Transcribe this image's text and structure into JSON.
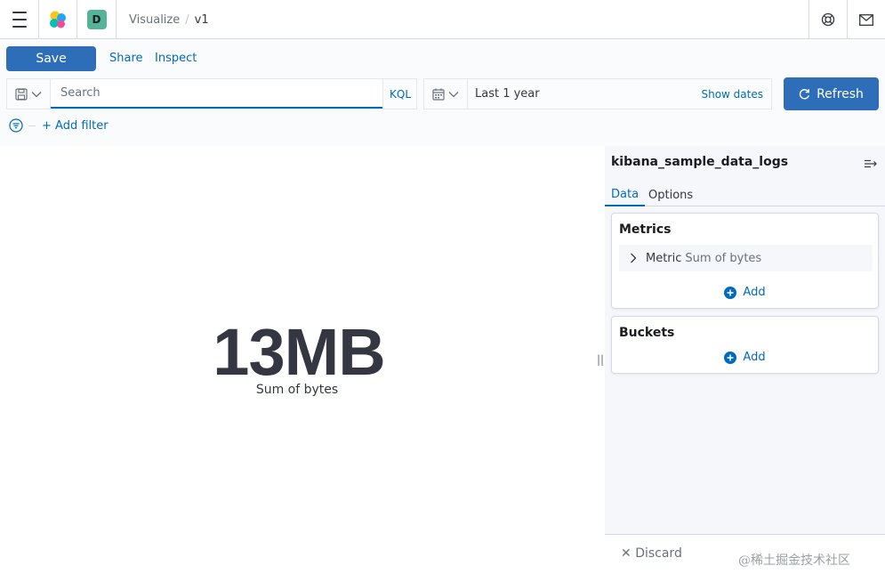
{
  "header": {
    "menu_icon": "hamburger-icon",
    "logo_icon": "kibana-logo-icon",
    "logo_colors": [
      "#f04e98",
      "#fec514",
      "#00bfb3",
      "#1ba9f5"
    ],
    "space_initial": "D",
    "space_color": "#54b399",
    "breadcrumb_parent": "Visualize",
    "breadcrumb_separator": "/",
    "breadcrumb_current": "v1",
    "help_icon": "help-icon",
    "mail_icon": "mail-icon"
  },
  "toolbar": {
    "save_label": "Save",
    "share_label": "Share",
    "inspect_label": "Inspect"
  },
  "query": {
    "saved_query_icon": "save-query-icon",
    "search_placeholder": "Search",
    "search_value": "",
    "language_label": "KQL"
  },
  "time": {
    "calendar_icon": "calendar-icon",
    "range_label": "Last 1 year",
    "show_dates_label": "Show dates",
    "refresh_label": "Refresh"
  },
  "filters": {
    "add_filter_label": "+ Add filter"
  },
  "visualization": {
    "value": "13MB",
    "label": "Sum of bytes"
  },
  "sidebar": {
    "index_pattern": "kibana_sample_data_logs",
    "tabs": [
      {
        "label": "Data",
        "active": true
      },
      {
        "label": "Options",
        "active": false
      }
    ],
    "metrics": {
      "title": "Metrics",
      "items": [
        {
          "type": "Metric",
          "description": "Sum of bytes"
        }
      ],
      "add_label": "Add"
    },
    "buckets": {
      "title": "Buckets",
      "add_label": "Add"
    },
    "discard_label": "Discard"
  },
  "watermark": "@稀土掘金技术社区",
  "colors": {
    "primary": "#2e6eb8",
    "link": "#006bb8",
    "text": "#343741",
    "subdued": "#69707d"
  }
}
